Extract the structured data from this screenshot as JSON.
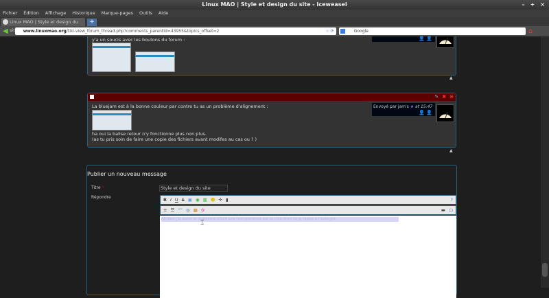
{
  "window": {
    "title": "Linux MAO | Style et design du site - Iceweasel",
    "controls": [
      "–",
      "+",
      "×"
    ]
  },
  "menu": [
    "Fichier",
    "Édition",
    "Affichage",
    "Historique",
    "Marque-pages",
    "Outils",
    "Aide"
  ],
  "tab": {
    "title": "Linux MAO | Style et design du site",
    "new": "+"
  },
  "nav": {
    "url_domain": "www.linuxmao.org",
    "url_path": "/tiki-view_forum_thread.php?comments_parentId=43955&topics_offset=2",
    "search_placeholder": "Google"
  },
  "posts": [
    {
      "text": "y'a un soucis avec les boutons du forum :"
    },
    {
      "text": "La bluejam est à la bonne couleur par contre tu as un problème d'alignement :",
      "text2": "ha oui la balise retour n'y fonctionne plus non plus.",
      "text3": "(as tu pris soin de faire une copie des fichiers avant modifes au cas ou ? )",
      "author": "Envoyé par jam's",
      "time": "at 15:47"
    }
  ],
  "form": {
    "heading": "Publier un nouveau message",
    "title_label": "Titre",
    "required": "*",
    "title_value": "Style et design du site",
    "reply_label": "Répondre",
    "editor_text": "Ah ben j'ai aussi le problème d'écriture transparence sur la chia donc là je tappe à l'aveugle"
  },
  "colors": {
    "post_bar": "#5c0000",
    "border": "#2b5f7a",
    "bg": "#1e1e1e"
  }
}
